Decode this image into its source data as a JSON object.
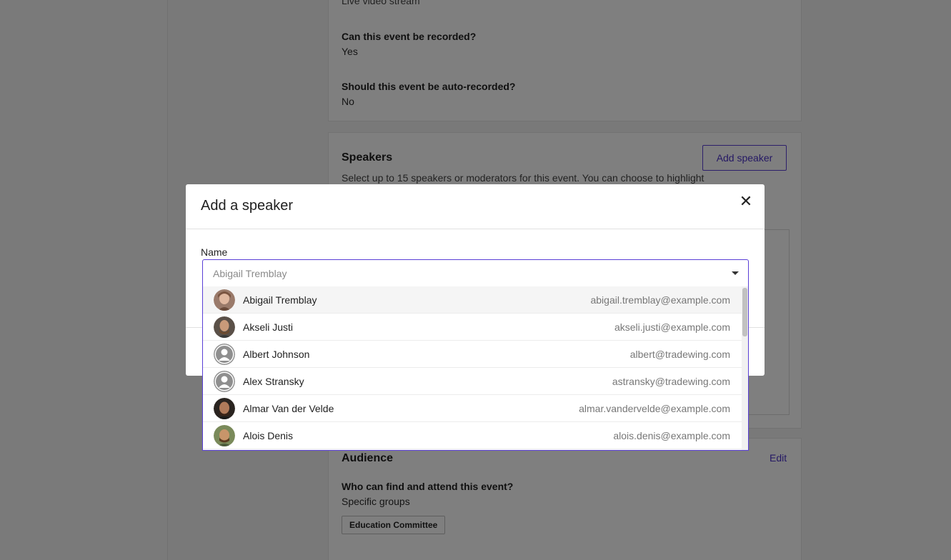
{
  "background": {
    "details": {
      "partial_text": "Live video stream",
      "q_recorded": "Can this event be recorded?",
      "a_recorded": "Yes",
      "q_autorecord": "Should this event be auto-recorded?",
      "a_autorecord": "No"
    },
    "speakers": {
      "title": "Speakers",
      "add_button": "Add speaker",
      "description": "Select up to 15 speakers or moderators for this event. You can choose to highlight"
    },
    "audience": {
      "title": "Audience",
      "edit_link": "Edit",
      "question": "Who can find and attend this event?",
      "answer": "Specific groups",
      "group_chip": "Education Committee"
    }
  },
  "modal": {
    "title": "Add a speaker",
    "close_icon": "close-icon",
    "name_label": "Name",
    "select_placeholder": "Abigail Tremblay",
    "options": [
      {
        "name": "Abigail Tremblay",
        "email": "abigail.tremblay@example.com",
        "avatar": "photo"
      },
      {
        "name": "Akseli Justi",
        "email": "akseli.justi@example.com",
        "avatar": "photo"
      },
      {
        "name": "Albert Johnson",
        "email": "albert@tradewing.com",
        "avatar": "default-user-icon"
      },
      {
        "name": "Alex Stransky",
        "email": "astransky@tradewing.com",
        "avatar": "default-user-icon"
      },
      {
        "name": "Almar Van der Velde",
        "email": "almar.vandervelde@example.com",
        "avatar": "photo"
      },
      {
        "name": "Alois Denis",
        "email": "alois.denis@example.com",
        "avatar": "photo"
      }
    ]
  },
  "colors": {
    "accent": "#5a3fd6",
    "overlay": "rgba(0,0,0,0.5)"
  }
}
